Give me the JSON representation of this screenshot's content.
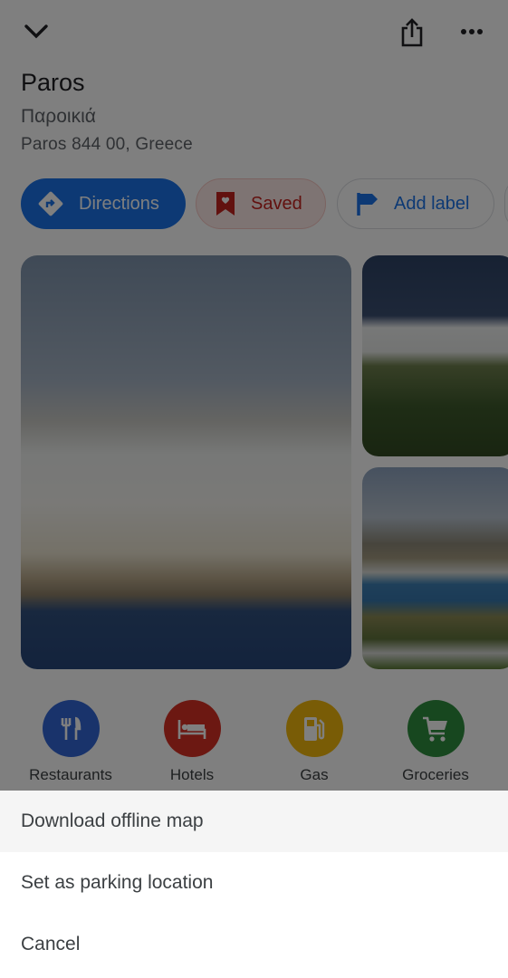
{
  "place": {
    "name": "Paros",
    "local_name": "Παροικιά",
    "address": "Paros 844 00, Greece"
  },
  "topbar": {
    "collapse_icon": "chevron-down-icon",
    "share_icon": "share-icon",
    "more_icon": "more-horiz-icon"
  },
  "actions": {
    "directions_label": "Directions",
    "saved_label": "Saved",
    "add_label_label": "Add label"
  },
  "photos": {
    "count_visible": 3
  },
  "categories": [
    {
      "label": "Restaurants",
      "icon": "restaurant-icon",
      "color": "#3367d6"
    },
    {
      "label": "Hotels",
      "icon": "hotel-icon",
      "color": "#d93025"
    },
    {
      "label": "Gas",
      "icon": "gas-station-icon",
      "color": "#f2b90c"
    },
    {
      "label": "Groceries",
      "icon": "shopping-cart-icon",
      "color": "#2f8f3f"
    }
  ],
  "sheet": {
    "items": [
      {
        "label": "Download offline map"
      },
      {
        "label": "Set as parking location"
      },
      {
        "label": "Cancel"
      }
    ]
  },
  "colors": {
    "primary_blue": "#1a73e8",
    "saved_red": "#c5221f",
    "saved_bg": "#fce8e6"
  }
}
